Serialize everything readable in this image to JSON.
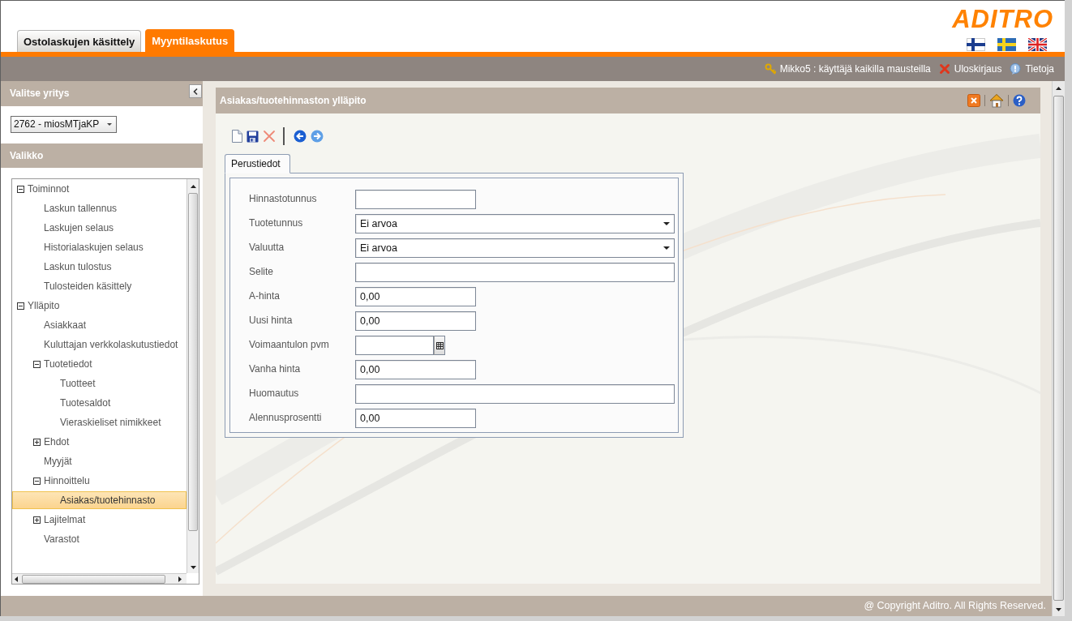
{
  "header": {
    "tabs": [
      {
        "label": "Ostolaskujen käsittely",
        "selected": false
      },
      {
        "label": "Myyntilaskutus",
        "selected": true
      }
    ],
    "logo": "ADITRO"
  },
  "user_bar": {
    "user": "Mikko5 : käyttäjä kaikilla mausteilla",
    "logout": "Uloskirjaus",
    "info": "Tietoja"
  },
  "sidebar": {
    "company_heading": "Valitse yritys",
    "company": "2762 - miosMTjaKP",
    "menu_heading": "Valikko",
    "menu": [
      {
        "label": "Toiminnot",
        "expanded": true,
        "selected": false,
        "children": [
          {
            "label": "Laskun tallennus",
            "selected": false
          },
          {
            "label": "Laskujen selaus",
            "selected": false
          },
          {
            "label": "Historialaskujen selaus",
            "selected": false
          },
          {
            "label": "Laskun tulostus",
            "selected": false
          },
          {
            "label": "Tulosteiden käsittely",
            "selected": false
          }
        ]
      },
      {
        "label": "Ylläpito",
        "expanded": true,
        "selected": false,
        "children": [
          {
            "label": "Asiakkaat",
            "selected": false
          },
          {
            "label": "Kuluttajan verkkolaskutustiedot",
            "selected": false
          },
          {
            "label": "Tuotetiedot",
            "expanded": true,
            "selected": false,
            "children": [
              {
                "label": "Tuotteet",
                "selected": false
              },
              {
                "label": "Tuotesaldot",
                "selected": false
              },
              {
                "label": "Vieraskieliset nimikkeet",
                "selected": false
              }
            ]
          },
          {
            "label": "Ehdot",
            "expanded": false,
            "selected": false
          },
          {
            "label": "Myyjät",
            "selected": false
          },
          {
            "label": "Hinnoittelu",
            "expanded": true,
            "selected": false,
            "children": [
              {
                "label": "Asiakas/tuotehinnasto",
                "selected": true
              }
            ]
          },
          {
            "label": "Lajitelmat",
            "expanded": false,
            "selected": false
          },
          {
            "label": "Varastot",
            "selected": false
          }
        ]
      }
    ]
  },
  "panel": {
    "title": "Asiakas/tuotehinnaston ylläpito",
    "tabs": [
      {
        "label": "Perustiedot",
        "selected": true
      }
    ],
    "fields": [
      {
        "label": "Hinnastotunnus",
        "kind": "id"
      },
      {
        "label": "Tuotetunnus",
        "kind": "select",
        "value": "Ei arvoa"
      },
      {
        "label": "Valuutta",
        "kind": "select",
        "value": "Ei arvoa"
      },
      {
        "label": "Selite",
        "kind": "text"
      },
      {
        "label": "A-hinta",
        "kind": "amount",
        "value": "0,00"
      },
      {
        "label": "Uusi hinta",
        "kind": "amount",
        "value": "0,00"
      },
      {
        "label": "Voimaantulon pvm",
        "kind": "date"
      },
      {
        "label": "Vanha hinta",
        "kind": "amount",
        "value": "0,00"
      },
      {
        "label": "Huomautus",
        "kind": "text"
      },
      {
        "label": "Alennusprosentti",
        "kind": "amount",
        "value": "0,00"
      }
    ]
  },
  "footer": {
    "copyright": "@ Copyright Aditro. All Rights Reserved."
  }
}
